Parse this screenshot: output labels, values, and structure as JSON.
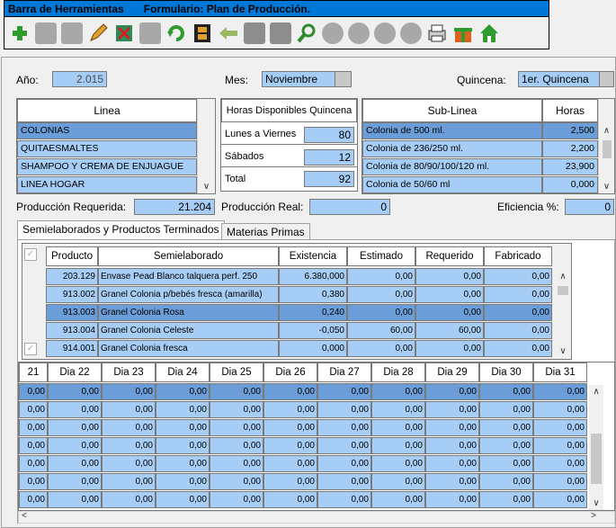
{
  "titlebar": {
    "app": "Barra de Herramientas",
    "form": "Formulario: Plan de Producción."
  },
  "toolbar": {
    "icons": [
      "add-icon",
      "save-icon",
      "save-disabled-icon",
      "edit-icon",
      "delete-icon",
      "undo-icon",
      "refresh-icon",
      "film-icon",
      "back-arrow-icon",
      "grid-icon",
      "grid2-icon",
      "search-icon",
      "first-icon",
      "prev-icon",
      "next-icon",
      "last-icon",
      "print-icon",
      "gift-icon",
      "home-icon"
    ]
  },
  "header": {
    "anio_label": "Año:",
    "anio_value": "2.015",
    "mes_label": "Mes:",
    "mes_value": "Noviembre",
    "quincena_label": "Quincena:",
    "quincena_value": "1er. Quincena"
  },
  "linea": {
    "header": "Linea",
    "items": [
      "COLONIAS",
      "QUITAESMALTES",
      "SHAMPOO Y CREMA DE ENJUAGUE",
      "LINEA HOGAR"
    ]
  },
  "horas": {
    "header": "Horas Disponibles Quincena",
    "rows": [
      {
        "label": "Lunes a Viernes",
        "value": "80"
      },
      {
        "label": "Sábados",
        "value": "12"
      },
      {
        "label": "Total",
        "value": "92"
      }
    ]
  },
  "sublinea": {
    "header": "Sub-Linea",
    "horas_header": "Horas",
    "rows": [
      {
        "name": "Colonia de 500 ml.",
        "horas": "2,500"
      },
      {
        "name": "Colonia de 236/250 ml.",
        "horas": "2,200"
      },
      {
        "name": "Colonia de 80/90/100/120 ml.",
        "horas": "23,900"
      },
      {
        "name": "Colonia de 50/60 ml",
        "horas": "0,000"
      }
    ]
  },
  "produccion": {
    "requerida_label": "Producción Requerida:",
    "requerida_value": "21.204",
    "real_label": "Producción Real:",
    "real_value": "0",
    "eficiencia_label": "Eficiencia %:",
    "eficiencia_value": "0"
  },
  "tabs": [
    "Semielaborados y Productos Terminados",
    "Materias Primas"
  ],
  "grid": {
    "headers": [
      "Producto",
      "Semielaborado",
      "Existencia",
      "Estimado",
      "Requerido",
      "Fabricado"
    ],
    "rows": [
      [
        "203.129",
        "Envase Pead Blanco talquera perf. 250",
        "6.380,000",
        "0,00",
        "0,00",
        "0,00"
      ],
      [
        "913.002",
        "Granel Colonia p/bebés fresca (amarilla)",
        "0,380",
        "0,00",
        "0,00",
        "0,00"
      ],
      [
        "913.003",
        "Granel Colonia Rosa",
        "0,240",
        "0,00",
        "0,00",
        "0,00"
      ],
      [
        "913.004",
        "Granel Colonia Celeste",
        "-0,050",
        "60,00",
        "60,00",
        "0,00"
      ],
      [
        "914.001",
        "Granel Colonia fresca",
        "0,000",
        "0,00",
        "0,00",
        "0,00"
      ]
    ]
  },
  "days": {
    "headers": [
      "21",
      "Dia 22",
      "Dia 23",
      "Dia 24",
      "Dia 25",
      "Dia 26",
      "Dia 27",
      "Dia 28",
      "Dia 29",
      "Dia 30",
      "Dia 31"
    ],
    "value": "0,00"
  }
}
